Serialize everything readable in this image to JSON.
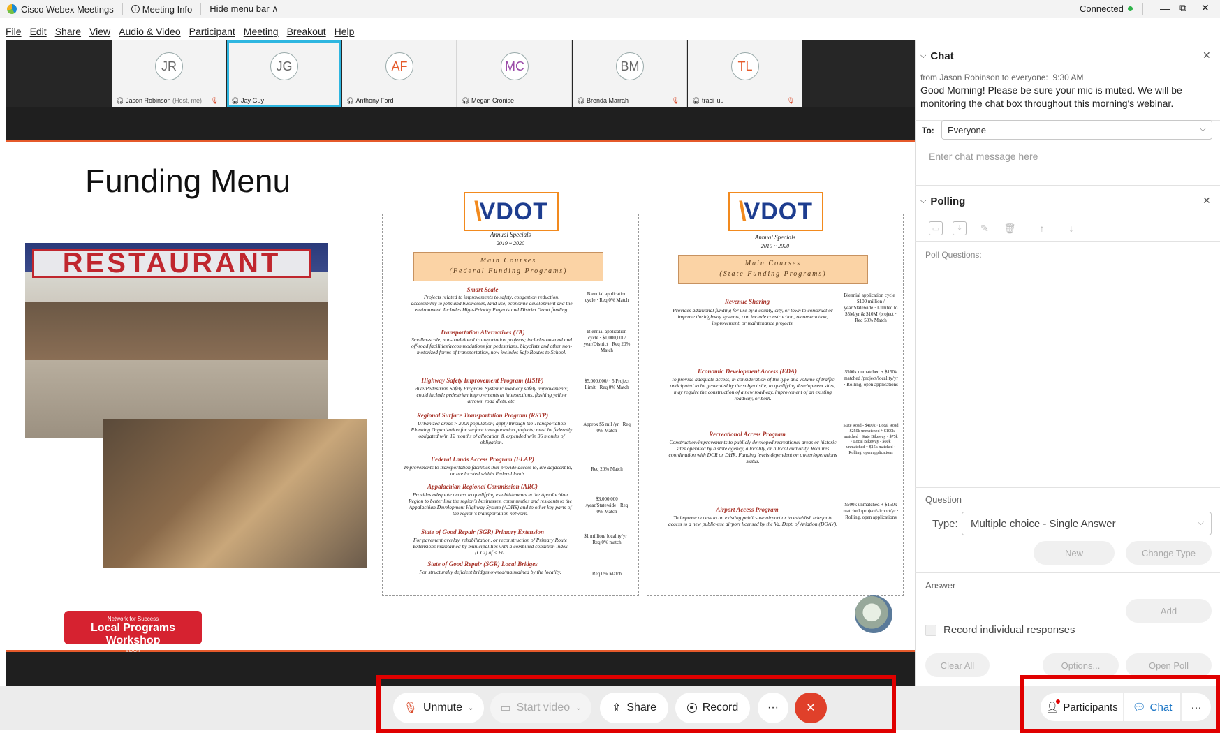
{
  "titlebar": {
    "app": "Cisco Webex Meetings",
    "meeting_info": "Meeting Info",
    "hide_menu": "Hide menu bar ∧",
    "status": "Connected",
    "minimize": "—",
    "maximize": "⧉",
    "close": "✕"
  },
  "menu": [
    "File",
    "Edit",
    "Share",
    "View",
    "Audio & Video",
    "Participant",
    "Meeting",
    "Breakout",
    "Help"
  ],
  "participants": [
    {
      "initials": "JR",
      "name": "Jason Robinson",
      "tag": "(Host, me)",
      "muted": true
    },
    {
      "initials": "JG",
      "name": "Jay Guy",
      "tag": "",
      "muted": false,
      "selected": true
    },
    {
      "initials": "AF",
      "name": "Anthony Ford",
      "tag": "",
      "muted": false
    },
    {
      "initials": "MC",
      "name": "Megan Cronise",
      "tag": "",
      "muted": false
    },
    {
      "initials": "BM",
      "name": "Brenda Marrah",
      "tag": "",
      "muted": true
    },
    {
      "initials": "TL",
      "name": "traci luu",
      "tag": "",
      "muted": true
    }
  ],
  "slide": {
    "title": "Funding Menu",
    "restaurant_sign": "RESTAURANT",
    "badge": {
      "top": "Network for Success",
      "main": "Local Programs Workshop",
      "logo": "VDOT"
    },
    "federal": {
      "logo": "VDOT",
      "sub1": "Annual Specials",
      "sub2": "2019 ~ 2020",
      "box1": "Main Courses",
      "box2": "(Federal Funding Programs)",
      "items": [
        {
          "h": "Smart Scale",
          "d": "Projects related to improvements to safety, congestion reduction, accessibility to jobs and businesses, land use, economic development and the environment. Includes High-Priority Projects and District Grant funding.",
          "r": "Biennial application cycle · Req 0% Match"
        },
        {
          "h": "Transportation Alternatives (TA)",
          "d": "Smaller-scale, non-traditional transportation projects; includes on-road and off-road facilities/accommodations for pedestrians, bicyclists and other non-motorized forms of transportation, now includes Safe Routes to School.",
          "r": "Biennial application cycle · $1,000,000/ year/District · Req 20% Match"
        },
        {
          "h": "Highway Safety Improvement Program (HSIP)",
          "d": "Bike/Pedestrian Safety Program, Systemic roadway safety improvements; could include pedestrian improvements at intersections, flashing yellow arrows, road diets, etc.",
          "r": "$5,000,000/ · 5 Project Limit · Req 0% Match"
        },
        {
          "h": "Regional Surface Transportation Program (RSTP)",
          "d": "Urbanized areas > 200k population; apply through the Transportation Planning Organization for surface transportation projects; must be federally obligated w/in 12 months of allocation & expended w/in 36 months of obligation.",
          "r": "Approx $5 mil /yr · Req 0% Match"
        },
        {
          "h": "Federal Lands Access Program (FLAP)",
          "d": "Improvements to transportation facilities that provide access to, are adjacent to, or are located within Federal lands.",
          "r": "Req 20% Match"
        },
        {
          "h": "Appalachian Regional Commission (ARC)",
          "d": "Provides adequate access to qualifying establishments in the Appalachian Region to better link the region's businesses, communities and residents to the Appalachian Development Highway System (ADHS) and to other key parts of the region's transportation network.",
          "r": "$3,000,000 /year/Statewide · Req 0% Match"
        },
        {
          "h": "State of Good Repair (SGR) Primary Extension",
          "d": "For pavement overlay, rehabilitation, or reconstruction of Primary Route Extensions maintained by municipalities with a combined condition index (CCI) of < 60.",
          "r": "$1 million/ locality/yr · Req 0% match"
        },
        {
          "h": "State of Good Repair (SGR) Local Bridges",
          "d": "For structurally deficient bridges owned/maintained by the locality.",
          "r": "Req 0% Match"
        }
      ]
    },
    "state": {
      "logo": "VDOT",
      "sub1": "Annual Specials",
      "sub2": "2019 ~ 2020",
      "box1": "Main Courses",
      "box2": "(State Funding Programs)",
      "items": [
        {
          "h": "Revenue Sharing",
          "d": "Provides additional funding for use by a county, city, or town to construct or improve the highway systems; can include construction, reconstruction, improvement, or maintenance projects.",
          "r": "Biennial application cycle · $100 million / year/Statewide · Limited to $5M/yr & $10M /project · Req 50% Match"
        },
        {
          "h": "Economic Development Access (EDA)",
          "d": "To provide adequate access, in consideration of the type and volume of traffic anticipated to be generated by the subject site, to qualifying development sites; may require the construction of a new roadway, improvement of an existing roadway, or both.",
          "r": "$500k unmatched + $150k matched /project/locality/yr · Rolling, open applications"
        },
        {
          "h": "Recreational Access Program",
          "d": "Construction/improvements to publicly developed recreational areas or historic sites operated by a state agency, a locality, or a local authority. Requires coordination with DCR or DHR. Funding levels dependent on owner/operations status.",
          "r": "State Road - $400k · Local Road - $250k unmatched + $100k matched · State Bikeway - $75k · Local Bikeway - $60k unmatched + $15k matched · Rolling, open applications"
        },
        {
          "h": "Airport Access Program",
          "d": "To improve access to an existing public-use airport or to establish adequate access to a new public-use airport licensed by the Va. Dept. of Aviation (DOAV).",
          "r": "$500k unmatched + $150k matched /project/airport/yr · Rolling, open applications"
        }
      ]
    }
  },
  "toolbar": {
    "unmute": "Unmute",
    "start_video": "Start video",
    "share": "Share",
    "record": "Record",
    "more": "···",
    "end": "✕"
  },
  "chat": {
    "header": "Chat",
    "from": "from Jason Robinson to everyone:",
    "time": "9:30 AM",
    "message": "Good Morning! Please be sure your mic is muted. We will be monitoring the chat box throughout this morning's webinar.",
    "to_label": "To:",
    "to_value": "Everyone",
    "placeholder": "Enter chat message here"
  },
  "polling": {
    "header": "Polling",
    "questions_label": "Poll Questions:",
    "question_label": "Question",
    "type_label": "Type:",
    "type_value": "Multiple choice - Single Answer",
    "new": "New",
    "change_type": "Change Type",
    "answer_label": "Answer",
    "add": "Add",
    "record_individual": "Record individual responses",
    "clear_all": "Clear All",
    "options": "Options...",
    "open_poll": "Open Poll"
  },
  "right_toolbar": {
    "participants": "Participants",
    "chat": "Chat",
    "more": "···"
  },
  "colors": {
    "accent": "#2eb6e0",
    "highlight_frame": "#e00000",
    "end_button": "#e0402a",
    "slide_rule": "#e55a2b"
  }
}
